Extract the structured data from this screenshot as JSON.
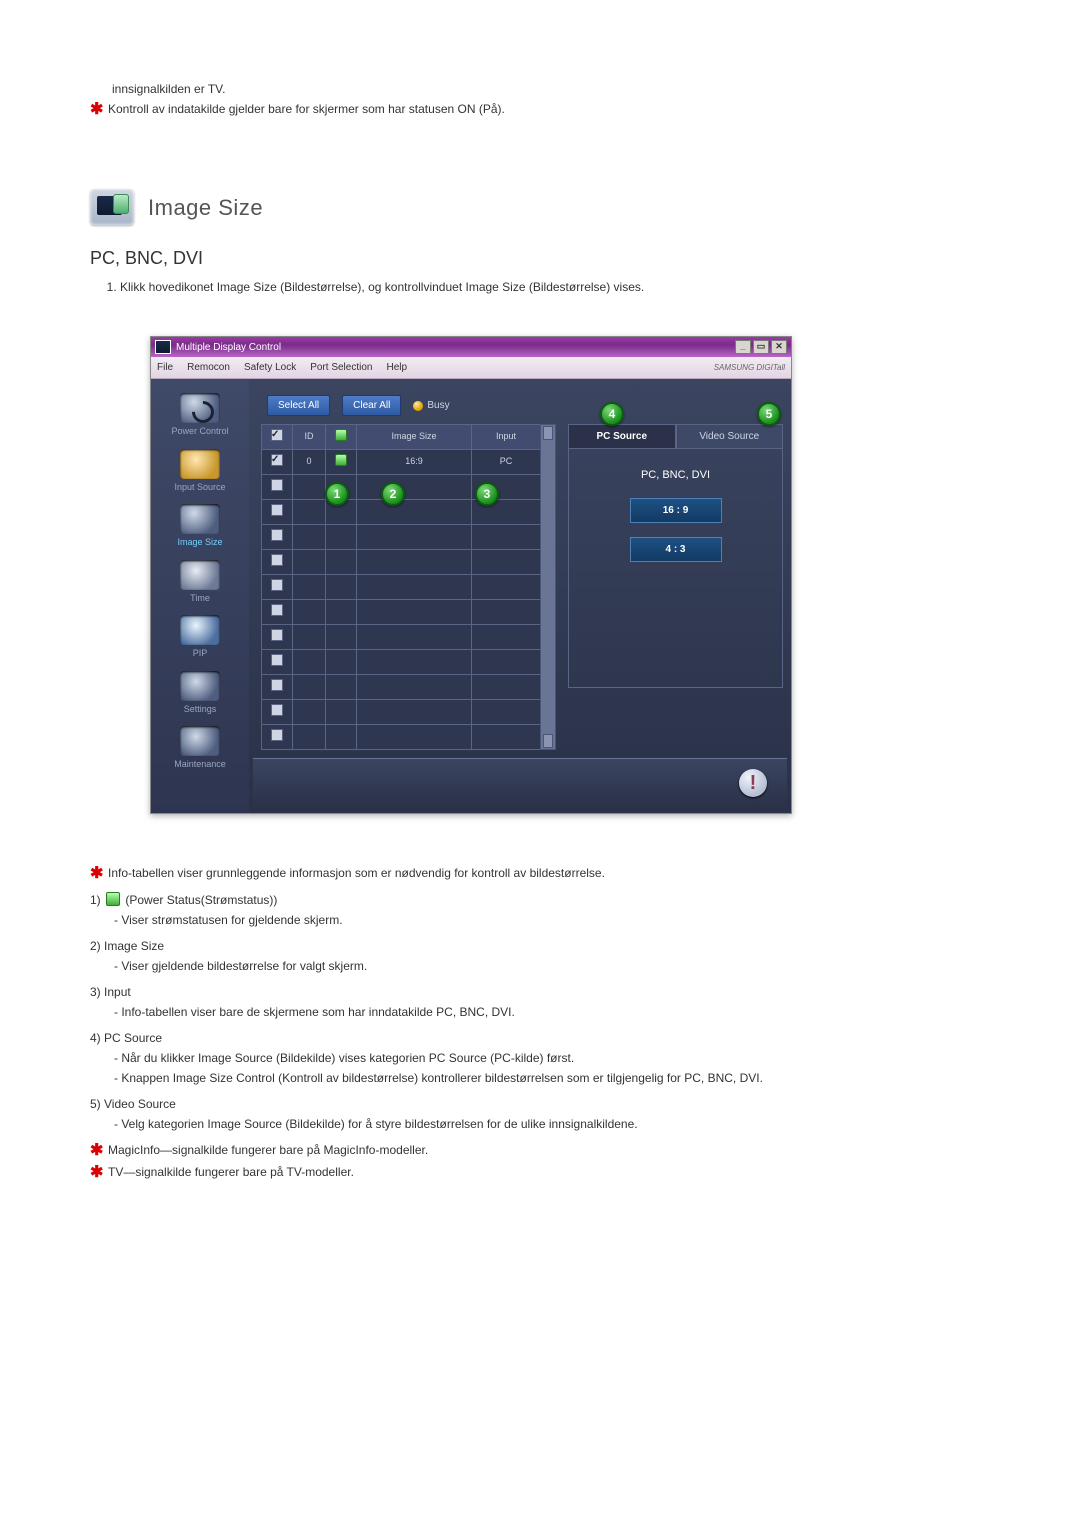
{
  "intro": {
    "line1": "innsignalkilden er TV.",
    "star_line": "Kontroll av indatakilde gjelder bare for skjermer som har statusen ON (På)."
  },
  "section": {
    "title": "Image Size",
    "subtitle": "PC, BNC, DVI",
    "step1": "Klikk hovedikonet Image Size (Bildestørrelse), og kontrollvinduet Image Size (Bildestørrelse) vises."
  },
  "app": {
    "window_title": "Multiple Display Control",
    "menus": [
      "File",
      "Remocon",
      "Safety Lock",
      "Port Selection",
      "Help"
    ],
    "brand": "SAMSUNG DIGITall",
    "buttons": {
      "select_all": "Select All",
      "clear_all": "Clear All"
    },
    "busy_label": "Busy",
    "sidebar": [
      {
        "label": "Power Control"
      },
      {
        "label": "Input Source"
      },
      {
        "label": "Image Size"
      },
      {
        "label": "Time"
      },
      {
        "label": "PIP"
      },
      {
        "label": "Settings"
      },
      {
        "label": "Maintenance"
      }
    ],
    "table": {
      "headers": [
        "",
        "ID",
        "",
        "Image Size",
        "Input"
      ],
      "rows": [
        {
          "checked": true,
          "id": "0",
          "status": "on",
          "image_size": "16:9",
          "input": "PC"
        }
      ],
      "empty_rows": 11
    },
    "right": {
      "tabs": [
        "PC Source",
        "Video Source"
      ],
      "active_tab": 0,
      "group_label": "PC, BNC, DVI",
      "options": [
        "16 : 9",
        "4 : 3"
      ]
    },
    "markers": [
      "1",
      "2",
      "3",
      "4",
      "5"
    ]
  },
  "explain": {
    "star1": "Info-tabellen viser grunnleggende informasjon som er nødvendig for kontroll av bildestørrelse.",
    "items": [
      {
        "num": "1)",
        "head": "(Power Status(Strømstatus))",
        "subs": [
          "- Viser strømstatusen for gjeldende skjerm."
        ]
      },
      {
        "num": "2)",
        "head": "Image Size",
        "subs": [
          "- Viser gjeldende bildestørrelse for valgt skjerm."
        ]
      },
      {
        "num": "3)",
        "head": "Input",
        "subs": [
          "- Info-tabellen viser bare de skjermene som har inndatakilde PC, BNC, DVI."
        ]
      },
      {
        "num": "4)",
        "head": "PC Source",
        "subs": [
          "- Når du klikker Image Source (Bildekilde) vises kategorien PC Source (PC-kilde) først.",
          "- Knappen Image Size Control (Kontroll av bildestørrelse) kontrollerer bildestørrelsen som er tilgjengelig for PC, BNC, DVI."
        ]
      },
      {
        "num": "5)",
        "head": "Video Source",
        "subs": [
          "- Velg kategorien Image Source (Bildekilde) for å styre bildestørrelsen for de ulike innsignalkildene."
        ]
      }
    ],
    "star2": "MagicInfo—signalkilde fungerer bare på MagicInfo-modeller.",
    "star3": "TV—signalkilde fungerer bare på TV-modeller."
  }
}
